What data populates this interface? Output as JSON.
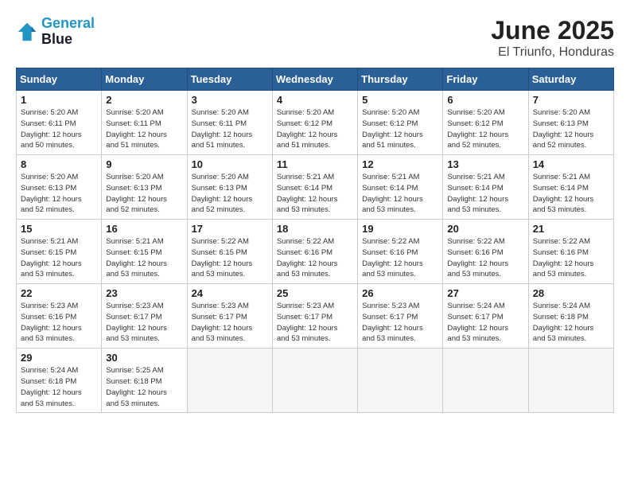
{
  "logo": {
    "line1": "General",
    "line2": "Blue"
  },
  "title": "June 2025",
  "location": "El Triunfo, Honduras",
  "days_of_week": [
    "Sunday",
    "Monday",
    "Tuesday",
    "Wednesday",
    "Thursday",
    "Friday",
    "Saturday"
  ],
  "weeks": [
    [
      {
        "day": "1",
        "sunrise": "5:20 AM",
        "sunset": "6:11 PM",
        "daylight": "12 hours and 50 minutes."
      },
      {
        "day": "2",
        "sunrise": "5:20 AM",
        "sunset": "6:11 PM",
        "daylight": "12 hours and 51 minutes."
      },
      {
        "day": "3",
        "sunrise": "5:20 AM",
        "sunset": "6:11 PM",
        "daylight": "12 hours and 51 minutes."
      },
      {
        "day": "4",
        "sunrise": "5:20 AM",
        "sunset": "6:12 PM",
        "daylight": "12 hours and 51 minutes."
      },
      {
        "day": "5",
        "sunrise": "5:20 AM",
        "sunset": "6:12 PM",
        "daylight": "12 hours and 51 minutes."
      },
      {
        "day": "6",
        "sunrise": "5:20 AM",
        "sunset": "6:12 PM",
        "daylight": "12 hours and 52 minutes."
      },
      {
        "day": "7",
        "sunrise": "5:20 AM",
        "sunset": "6:13 PM",
        "daylight": "12 hours and 52 minutes."
      }
    ],
    [
      {
        "day": "8",
        "sunrise": "5:20 AM",
        "sunset": "6:13 PM",
        "daylight": "12 hours and 52 minutes."
      },
      {
        "day": "9",
        "sunrise": "5:20 AM",
        "sunset": "6:13 PM",
        "daylight": "12 hours and 52 minutes."
      },
      {
        "day": "10",
        "sunrise": "5:20 AM",
        "sunset": "6:13 PM",
        "daylight": "12 hours and 52 minutes."
      },
      {
        "day": "11",
        "sunrise": "5:21 AM",
        "sunset": "6:14 PM",
        "daylight": "12 hours and 53 minutes."
      },
      {
        "day": "12",
        "sunrise": "5:21 AM",
        "sunset": "6:14 PM",
        "daylight": "12 hours and 53 minutes."
      },
      {
        "day": "13",
        "sunrise": "5:21 AM",
        "sunset": "6:14 PM",
        "daylight": "12 hours and 53 minutes."
      },
      {
        "day": "14",
        "sunrise": "5:21 AM",
        "sunset": "6:14 PM",
        "daylight": "12 hours and 53 minutes."
      }
    ],
    [
      {
        "day": "15",
        "sunrise": "5:21 AM",
        "sunset": "6:15 PM",
        "daylight": "12 hours and 53 minutes."
      },
      {
        "day": "16",
        "sunrise": "5:21 AM",
        "sunset": "6:15 PM",
        "daylight": "12 hours and 53 minutes."
      },
      {
        "day": "17",
        "sunrise": "5:22 AM",
        "sunset": "6:15 PM",
        "daylight": "12 hours and 53 minutes."
      },
      {
        "day": "18",
        "sunrise": "5:22 AM",
        "sunset": "6:16 PM",
        "daylight": "12 hours and 53 minutes."
      },
      {
        "day": "19",
        "sunrise": "5:22 AM",
        "sunset": "6:16 PM",
        "daylight": "12 hours and 53 minutes."
      },
      {
        "day": "20",
        "sunrise": "5:22 AM",
        "sunset": "6:16 PM",
        "daylight": "12 hours and 53 minutes."
      },
      {
        "day": "21",
        "sunrise": "5:22 AM",
        "sunset": "6:16 PM",
        "daylight": "12 hours and 53 minutes."
      }
    ],
    [
      {
        "day": "22",
        "sunrise": "5:23 AM",
        "sunset": "6:16 PM",
        "daylight": "12 hours and 53 minutes."
      },
      {
        "day": "23",
        "sunrise": "5:23 AM",
        "sunset": "6:17 PM",
        "daylight": "12 hours and 53 minutes."
      },
      {
        "day": "24",
        "sunrise": "5:23 AM",
        "sunset": "6:17 PM",
        "daylight": "12 hours and 53 minutes."
      },
      {
        "day": "25",
        "sunrise": "5:23 AM",
        "sunset": "6:17 PM",
        "daylight": "12 hours and 53 minutes."
      },
      {
        "day": "26",
        "sunrise": "5:23 AM",
        "sunset": "6:17 PM",
        "daylight": "12 hours and 53 minutes."
      },
      {
        "day": "27",
        "sunrise": "5:24 AM",
        "sunset": "6:17 PM",
        "daylight": "12 hours and 53 minutes."
      },
      {
        "day": "28",
        "sunrise": "5:24 AM",
        "sunset": "6:18 PM",
        "daylight": "12 hours and 53 minutes."
      }
    ],
    [
      {
        "day": "29",
        "sunrise": "5:24 AM",
        "sunset": "6:18 PM",
        "daylight": "12 hours and 53 minutes."
      },
      {
        "day": "30",
        "sunrise": "5:25 AM",
        "sunset": "6:18 PM",
        "daylight": "12 hours and 53 minutes."
      },
      null,
      null,
      null,
      null,
      null
    ]
  ]
}
